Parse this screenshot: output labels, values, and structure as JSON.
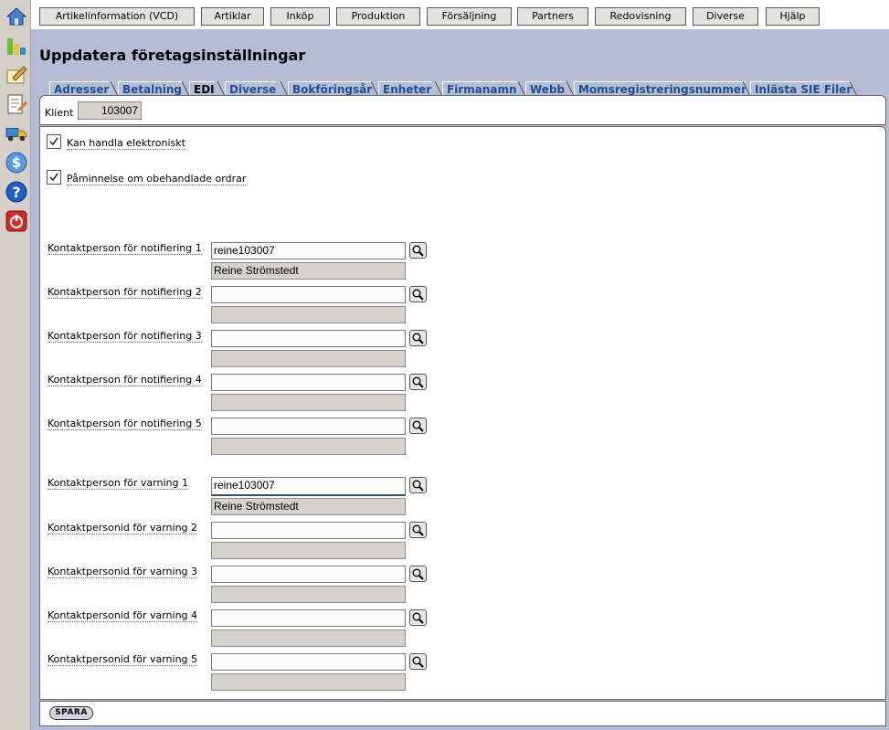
{
  "menu": [
    {
      "label": "Artikelinformation (VCD)"
    },
    {
      "label": "Artiklar"
    },
    {
      "label": "Inköp"
    },
    {
      "label": "Produktion"
    },
    {
      "label": "Försäljning"
    },
    {
      "label": "Partners"
    },
    {
      "label": "Redovisning"
    },
    {
      "label": "Diverse"
    },
    {
      "label": "Hjälp"
    }
  ],
  "page_title": "Uppdatera företagsinställningar",
  "tabs": [
    {
      "label": "Adresser"
    },
    {
      "label": "Betalning"
    },
    {
      "label": "EDI",
      "active": true
    },
    {
      "label": "Diverse"
    },
    {
      "label": "Bokföringsår"
    },
    {
      "label": "Enheter"
    },
    {
      "label": "Firmanamn"
    },
    {
      "label": "Webb"
    },
    {
      "label": "Momsregistreringsnummer"
    },
    {
      "label": "Inlästa SIE Filer"
    }
  ],
  "client": {
    "label": "Klient",
    "value": "103007"
  },
  "checkboxes": [
    {
      "label": "Kan handla elektroniskt",
      "checked": true
    },
    {
      "label": "Påminnelse om obehandlade ordrar",
      "checked": true
    }
  ],
  "notification_fields": [
    {
      "label": "Kontaktperson för notifiering 1",
      "value": "reine103007",
      "name": "Reine Strömstedt"
    },
    {
      "label": "Kontaktperson för notifiering 2",
      "value": "",
      "name": ""
    },
    {
      "label": "Kontaktperson för notifiering 3",
      "value": "",
      "name": ""
    },
    {
      "label": "Kontaktperson för notifiering 4",
      "value": "",
      "name": ""
    },
    {
      "label": "Kontaktperson för notifiering 5",
      "value": "",
      "name": ""
    }
  ],
  "warning_fields": [
    {
      "label": "Kontaktperson för varning 1",
      "value": "reine103007",
      "name": "Reine Strömstedt"
    },
    {
      "label": "Kontaktpersonid för varning 2",
      "value": "",
      "name": ""
    },
    {
      "label": "Kontaktpersonid för varning 3",
      "value": "",
      "name": ""
    },
    {
      "label": "Kontaktpersonid för varning 4",
      "value": "",
      "name": ""
    },
    {
      "label": "Kontaktpersonid för varning 5",
      "value": "",
      "name": ""
    }
  ],
  "save_button": "SPARA",
  "left_icons": [
    "home-icon",
    "chart-icon",
    "notepad-icon",
    "document-edit-icon",
    "truck-icon",
    "dollar-icon",
    "help-icon",
    "power-icon"
  ]
}
